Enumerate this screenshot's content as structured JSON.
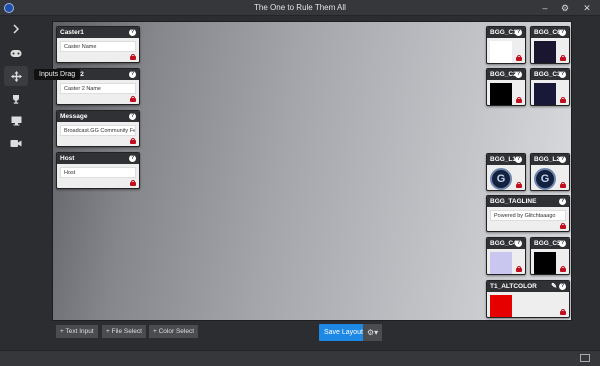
{
  "window": {
    "title": "The One to Rule Them All"
  },
  "sidebar": {
    "tooltip": "Inputs Drag"
  },
  "left_cards": [
    {
      "title": "Caster1",
      "value": "Caster Name"
    },
    {
      "title": "Caster2",
      "value": "Caster 2 Name"
    },
    {
      "title": "Message",
      "value": "Broadcast.GG Community Fe..."
    },
    {
      "title": "Host",
      "value": "Host"
    }
  ],
  "right_cards": {
    "bgg_c1": {
      "title": "BGG_C1",
      "color": "#ffffff"
    },
    "bgg_c6": {
      "title": "BGG_C6",
      "color": "#1a1630"
    },
    "bgg_c2": {
      "title": "BGG_C2",
      "color": "#000000"
    },
    "bgg_c3": {
      "title": "BGG_C3",
      "color": "#1a1838"
    },
    "bgg_l1": {
      "title": "BGG_L1"
    },
    "bgg_l2": {
      "title": "BGG_L2"
    },
    "tagline": {
      "title": "BGG_TAGLINE",
      "value": "Powered by Glitchtaaago"
    },
    "bgg_c4": {
      "title": "BGG_C4",
      "color": "#c9c6ef"
    },
    "bgg_c5": {
      "title": "BGG_C5",
      "color": "#000000"
    },
    "altcolor": {
      "title": "T1_ALTCOLOR",
      "color": "#e60000"
    }
  },
  "toolbar": {
    "text_input": "+ Text Input",
    "file_select": "+ File Select",
    "color_select": "+ Color Select",
    "save_layout": "Save Layout"
  },
  "icons": {
    "help": "?",
    "logo_letter": "G",
    "gear": "⚙",
    "caret": "▾",
    "edit": "✎",
    "minimize": "–",
    "settings": "⚙",
    "close": "✕"
  }
}
